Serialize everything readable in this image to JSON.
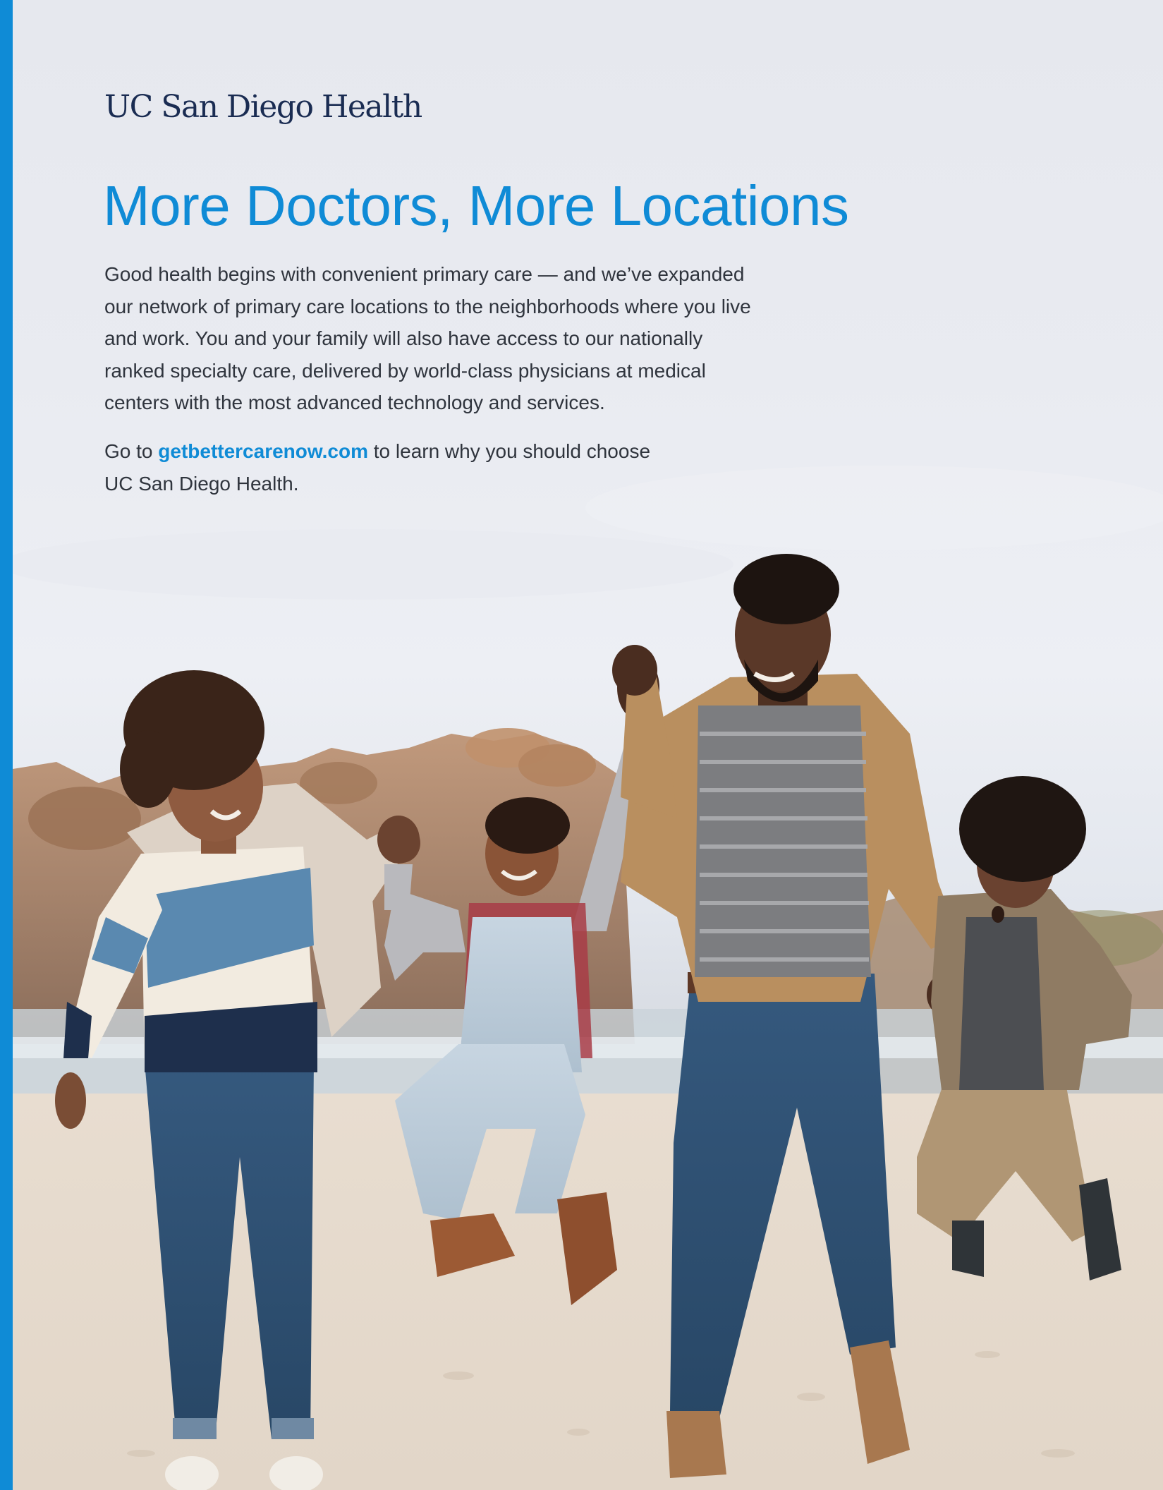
{
  "brand": {
    "name": "UC San Diego Health",
    "accent_color": "#0f8bd6",
    "logo_color": "#1a2c52"
  },
  "headline": "More Doctors, More Locations",
  "body": "Good health begins with convenient primary care — and we’ve expanded our network of primary care locations to the neighborhoods where you live and work. You and your family will also have access to our nationally ranked specialty care, delivered by world-class physicians at medical centers with the most advanced technology and services.",
  "cta": {
    "prefix": "Go to ",
    "link_text": "getbettercarenow.com",
    "suffix": " to learn why you should choose UC San Diego Health."
  },
  "photo": {
    "icon": "family-on-beach-photo"
  }
}
